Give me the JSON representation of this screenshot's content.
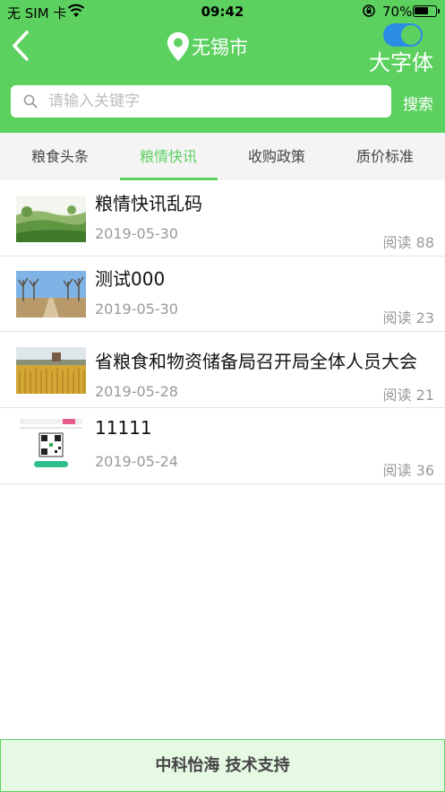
{
  "status_bar": {
    "carrier": "无 SIM 卡",
    "time": "09:42",
    "battery_percent": "70%",
    "battery_level": 0.7
  },
  "header": {
    "city": "无锡市",
    "big_font_label": "大字体",
    "big_font_enabled": true,
    "accent_color": "#5dd160"
  },
  "search": {
    "placeholder": "请输入关键字",
    "value": "",
    "button_label": "搜索"
  },
  "tabs": [
    {
      "label": "粮食头条",
      "active": false
    },
    {
      "label": "粮情快讯",
      "active": true
    },
    {
      "label": "收购政策",
      "active": false
    },
    {
      "label": "质价标准",
      "active": false
    }
  ],
  "news": [
    {
      "title": "粮情快讯乱码",
      "date": "2019-05-30",
      "reads": "阅读 88",
      "thumb": "green-field"
    },
    {
      "title": "测试000",
      "date": "2019-05-30",
      "reads": "阅读 23",
      "thumb": "tree-road"
    },
    {
      "title": "省粮食和物资储备局召开局全体人员大会",
      "date": "2019-05-28",
      "reads": "阅读 21",
      "thumb": "wheat-field"
    },
    {
      "title": "11111",
      "date": "2019-05-24",
      "reads": "阅读 36",
      "thumb": "qr-card"
    }
  ],
  "footer": {
    "text": "中科怡海 技术支持"
  }
}
